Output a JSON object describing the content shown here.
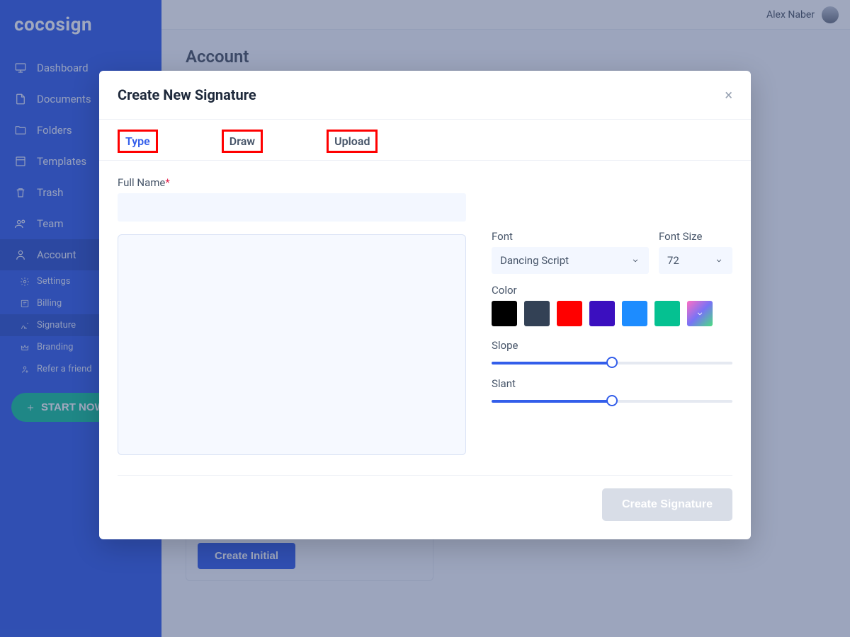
{
  "app": {
    "logo": "cocosign"
  },
  "user": {
    "name": "Alex Naber"
  },
  "sidebar": {
    "items": [
      {
        "label": "Dashboard"
      },
      {
        "label": "Documents"
      },
      {
        "label": "Folders"
      },
      {
        "label": "Templates"
      },
      {
        "label": "Trash"
      },
      {
        "label": "Team"
      },
      {
        "label": "Account"
      }
    ],
    "sub": [
      {
        "label": "Settings"
      },
      {
        "label": "Billing"
      },
      {
        "label": "Signature"
      },
      {
        "label": "Branding"
      },
      {
        "label": "Refer a friend"
      }
    ],
    "cta": "START NOW"
  },
  "page": {
    "title": "Account",
    "create_initial": "Create Initial"
  },
  "modal": {
    "title": "Create New Signature",
    "close": "×",
    "tabs": {
      "type": "Type",
      "draw": "Draw",
      "upload": "Upload"
    },
    "full_name_label": "Full Name",
    "font_label": "Font",
    "font_value": "Dancing Script",
    "size_label": "Font Size",
    "size_value": "72",
    "color_label": "Color",
    "colors": [
      "#000000",
      "#334155",
      "#ff0000",
      "#3b0fbf",
      "#1d8cff",
      "#05c191"
    ],
    "more_color_gradient": "linear-gradient(135deg,#ff6ec4,#7873f5,#4ade80)",
    "slope_label": "Slope",
    "slant_label": "Slant",
    "submit": "Create Signature"
  }
}
